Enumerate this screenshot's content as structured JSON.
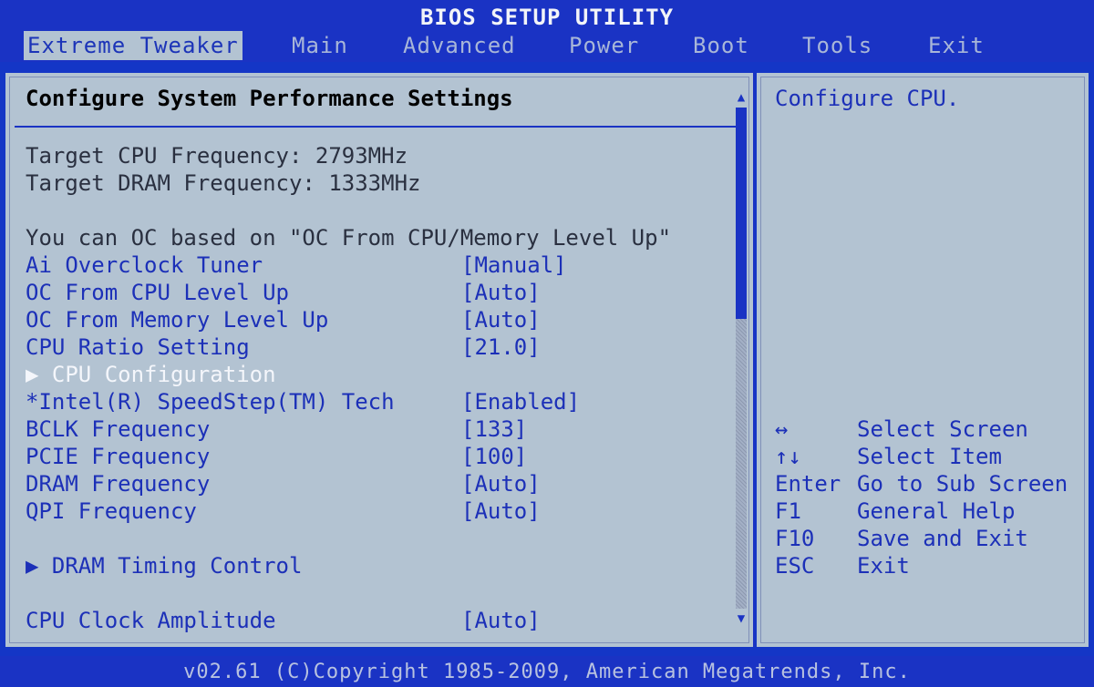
{
  "title": "BIOS SETUP UTILITY",
  "menu": [
    {
      "label": "Extreme Tweaker",
      "active": true
    },
    {
      "label": "Main"
    },
    {
      "label": "Advanced"
    },
    {
      "label": "Power"
    },
    {
      "label": "Boot"
    },
    {
      "label": "Tools"
    },
    {
      "label": "Exit"
    }
  ],
  "main": {
    "heading": "Configure System Performance Settings",
    "info": [
      "Target CPU Frequency: 2793MHz",
      "Target DRAM Frequency: 1333MHz",
      "You can OC based on \"OC From CPU/Memory Level Up\""
    ],
    "options": [
      {
        "label": "Ai Overclock Tuner",
        "value": "[Manual]"
      },
      {
        "label": "OC From CPU Level Up",
        "value": "[Auto]"
      },
      {
        "label": "OC From Memory Level Up",
        "value": "[Auto]"
      },
      {
        "label": "CPU Ratio Setting",
        "value": "[21.0]"
      },
      {
        "label": "▶ CPU Configuration",
        "value": ""
      },
      {
        "label": "*Intel(R) SpeedStep(TM) Tech",
        "value": "[Enabled]"
      },
      {
        "label": "BCLK Frequency",
        "value": "[133]"
      },
      {
        "label": "PCIE Frequency",
        "value": "[100]"
      },
      {
        "label": "DRAM Frequency",
        "value": "[Auto]"
      },
      {
        "label": "QPI Frequency",
        "value": "[Auto]"
      },
      {
        "label": "▶ DRAM Timing Control",
        "value": ""
      },
      {
        "label": "CPU Clock Amplitude",
        "value": "[Auto]"
      }
    ]
  },
  "side": {
    "help": "Configure CPU.",
    "keys": [
      {
        "key": "↔",
        "desc": "Select Screen"
      },
      {
        "key": "↑↓",
        "desc": "Select Item"
      },
      {
        "key": "Enter",
        "desc": "Go to Sub Screen"
      },
      {
        "key": "F1",
        "desc": "General Help"
      },
      {
        "key": "F10",
        "desc": "Save and Exit"
      },
      {
        "key": "ESC",
        "desc": "Exit"
      }
    ]
  },
  "footer": "v02.61 (C)Copyright 1985-2009, American Megatrends, Inc.",
  "colors": {
    "background": "#1436c6",
    "panel": "#b3c3d2",
    "highlight_text": "#f4f6fb",
    "option_text": "#1c30b8",
    "info_text": "#2a3040"
  }
}
